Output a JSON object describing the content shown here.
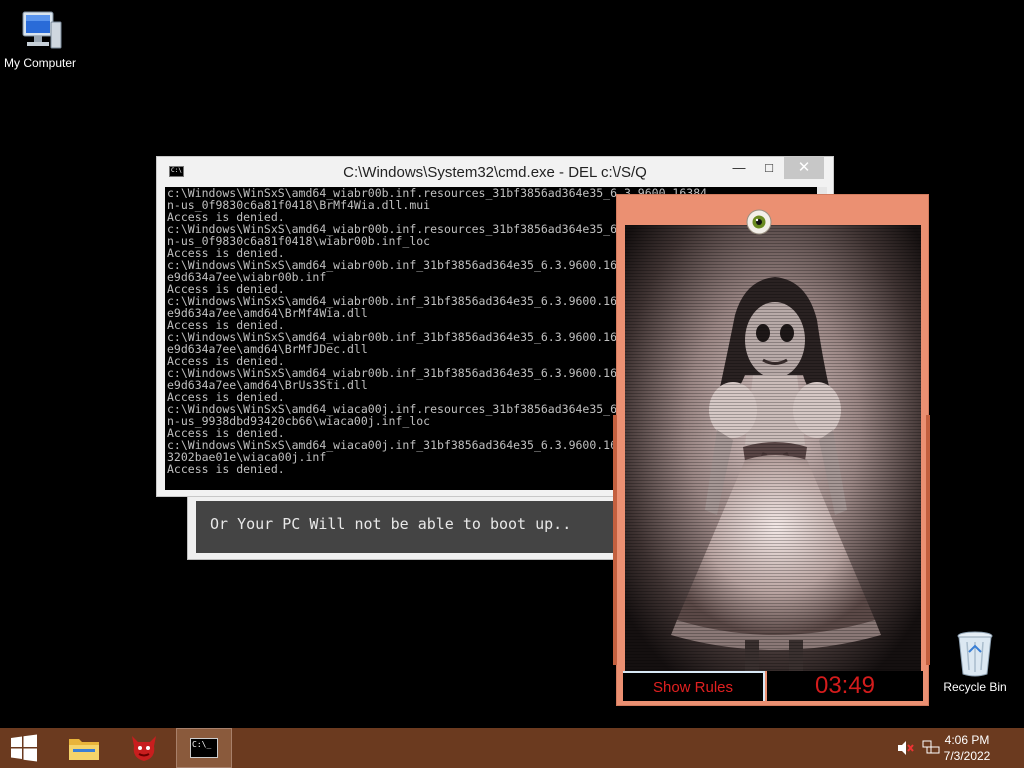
{
  "desktop": {
    "my_computer_label": "My Computer",
    "recycle_bin_label": "Recycle Bin"
  },
  "back_window": {
    "message": "Or Your PC Will not be able to boot up.."
  },
  "cmd_window": {
    "title": "C:\\Windows\\System32\\cmd.exe - DEL  c:\\/S/Q",
    "lines": [
      "c:\\Windows\\WinSxS\\amd64_wiabr00b.inf.resources_31bf3856ad364e35_6.3.9600.16384",
      "n-us_0f9830c6a81f0418\\BrMf4Wia.dll.mui",
      "Access is denied.",
      "c:\\Windows\\WinSxS\\amd64_wiabr00b.inf.resources_31bf3856ad364e35_6.3.9600.16384",
      "n-us_0f9830c6a81f0418\\wiabr00b.inf_loc",
      "Access is denied.",
      "c:\\Windows\\WinSxS\\amd64_wiabr00b.inf_31bf3856ad364e35_6.3.9600.16384_none_",
      "e9d634a7ee\\wiabr00b.inf",
      "Access is denied.",
      "c:\\Windows\\WinSxS\\amd64_wiabr00b.inf_31bf3856ad364e35_6.3.9600.16384_none_",
      "e9d634a7ee\\amd64\\BrMf4Wia.dll",
      "Access is denied.",
      "c:\\Windows\\WinSxS\\amd64_wiabr00b.inf_31bf3856ad364e35_6.3.9600.16384_none_",
      "e9d634a7ee\\amd64\\BrMfJDec.dll",
      "Access is denied.",
      "c:\\Windows\\WinSxS\\amd64_wiabr00b.inf_31bf3856ad364e35_6.3.9600.16384_none_",
      "e9d634a7ee\\amd64\\BrUs3Sti.dll",
      "Access is denied.",
      "c:\\Windows\\WinSxS\\amd64_wiaca00j.inf.resources_31bf3856ad364e35_6.3.9600.16384",
      "n-us_9938dbd93420cb66\\wiaca00j.inf_loc",
      "Access is denied.",
      "c:\\Windows\\WinSxS\\amd64_wiaca00j.inf_31bf3856ad364e35_6.3.9600.16384_none_",
      "3202bae01e\\wiaca00j.inf",
      "Access is denied."
    ],
    "min_glyph": "—",
    "max_glyph": "□",
    "close_glyph": "✕"
  },
  "scary_window": {
    "rules_button_label": "Show Rules",
    "timer": "03:49"
  },
  "taskbar": {
    "time": "4:06 PM",
    "date": "7/3/2022"
  },
  "colors": {
    "taskbar": "#6b3a1f",
    "scary_frame": "#eb9072",
    "timer_red": "#d41c1c"
  }
}
